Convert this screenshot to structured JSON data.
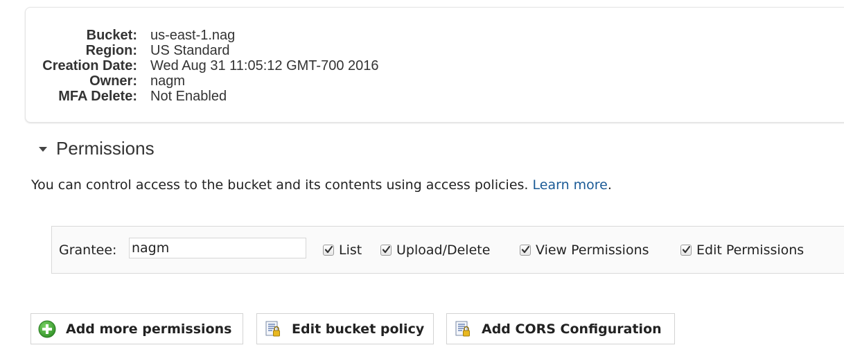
{
  "properties": [
    {
      "label": "Bucket:",
      "value": "us-east-1.nag"
    },
    {
      "label": "Region:",
      "value": "US Standard"
    },
    {
      "label": "Creation Date:",
      "value": "Wed Aug 31 11:05:12 GMT-700 2016"
    },
    {
      "label": "Owner:",
      "value": "nagm"
    },
    {
      "label": "MFA Delete:",
      "value": "Not Enabled"
    }
  ],
  "permissions": {
    "title": "Permissions",
    "description": "You can control access to the bucket and its contents using access policies.",
    "learn_more": "Learn more",
    "period": ".",
    "grantee_label": "Grantee:",
    "grantee_value": "nagm",
    "checks": [
      {
        "label": "List",
        "checked": true
      },
      {
        "label": "Upload/Delete",
        "checked": true
      },
      {
        "label": "View Permissions",
        "checked": true
      },
      {
        "label": "Edit Permissions",
        "checked": true
      }
    ]
  },
  "buttons": {
    "add_permissions": "Add more permissions",
    "edit_policy": "Edit bucket policy",
    "add_cors": "Add CORS Configuration"
  },
  "colors": {
    "link": "#1a5a96",
    "add_icon": "#3fa535",
    "policy_icon_lock": "#e8b820"
  },
  "icons": {
    "add": "plus-circle-icon",
    "policy": "document-lock-icon",
    "cors": "document-lock-icon"
  }
}
